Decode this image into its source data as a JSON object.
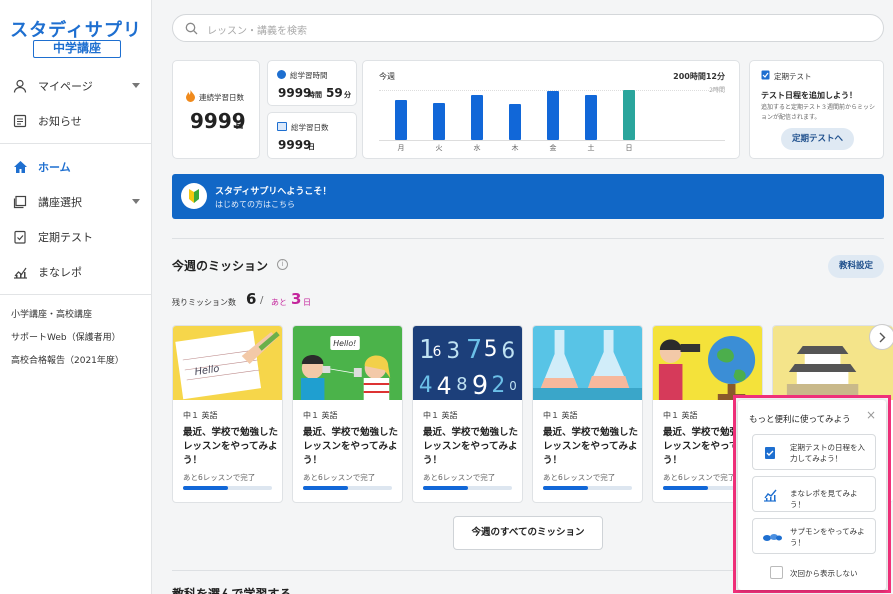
{
  "sidebar": {
    "logo": "スタディサプリ",
    "logo_sub": "中学講座",
    "items": [
      {
        "label": "マイページ",
        "icon": "person-icon"
      },
      {
        "label": "お知らせ",
        "icon": "notice-icon"
      },
      {
        "label": "ホーム",
        "icon": "home-icon"
      },
      {
        "label": "講座選択",
        "icon": "course-icon"
      },
      {
        "label": "定期テスト",
        "icon": "test-icon"
      },
      {
        "label": "まなレポ",
        "icon": "chart-icon"
      }
    ],
    "links": [
      "小学講座・高校講座",
      "サポートWeb（保護者用）",
      "高校合格報告（2021年度）"
    ]
  },
  "search": {
    "placeholder": "レッスン・講義を検索"
  },
  "stats": {
    "streak_label": "連続学習日数",
    "streak_value": "9999",
    "streak_unit": "日",
    "total_time_label": "総学習時間",
    "total_time_h": "9999",
    "total_time_h_unit": "時間",
    "total_time_m": "59",
    "total_time_m_unit": "分",
    "total_days_label": "総学習日数",
    "total_days_value": "9999",
    "total_days_unit": "日"
  },
  "weekly": {
    "label": "今週",
    "total": "200時間12分",
    "axis_max": "2時間"
  },
  "chart_data": {
    "type": "bar",
    "title": "今週",
    "categories": [
      "月",
      "火",
      "水",
      "木",
      "金",
      "土",
      "日"
    ],
    "values": [
      1.6,
      1.5,
      1.8,
      1.45,
      1.95,
      1.82,
      2.0
    ],
    "ylim": [
      0,
      2
    ],
    "colors": [
      "#1167d8",
      "#1167d8",
      "#1167d8",
      "#1167d8",
      "#1167d8",
      "#1167d8",
      "#2aa59c"
    ]
  },
  "test_card": {
    "label": "定期テスト",
    "title": "テスト日程を追加しよう！",
    "desc": "追加すると定期テスト３週間前からミッションが配信されます。",
    "button": "定期テストへ"
  },
  "banner": {
    "title": "スタディサプリへようこそ！",
    "sub": "はじめての方はこちら"
  },
  "missions": {
    "heading": "今週のミッション",
    "settings_button": "教科設定",
    "remaining_label": "残りミッション数",
    "remaining_count": "6",
    "slash": "/",
    "days_prefix": "あと",
    "days_count": "3",
    "days_unit": "日",
    "cards": [
      {
        "subject": "中１ 英語",
        "title": "最近、学校で勉強したレッスンをやってみよう！",
        "rest": "あと6レッスンで完了",
        "progress": 0.5,
        "art": "Hello"
      },
      {
        "subject": "中１ 英語",
        "title": "最近、学校で勉強したレッスンをやってみよう！",
        "rest": "あと6レッスンで完了",
        "progress": 0.5,
        "art": "Hello!"
      },
      {
        "subject": "中１ 英語",
        "title": "最近、学校で勉強したレッスンをやってみよう！",
        "rest": "あと6レッスンで完了",
        "progress": 0.5,
        "art": "numbers"
      },
      {
        "subject": "中１ 英語",
        "title": "最近、学校で勉強したレッスンをやってみよう！",
        "rest": "あと6レッスンで完了",
        "progress": 0.5,
        "art": "flasks"
      },
      {
        "subject": "中１ 英語",
        "title": "最近、学校で勉強したレッスンをやってみよう！",
        "rest": "あと6レッスンで完了",
        "progress": 0.5,
        "art": "globe"
      }
    ],
    "all_button": "今週のすべてのミッション"
  },
  "next_heading": "教科を選んで学習する",
  "popup": {
    "title": "もっと便利に使ってみよう",
    "items": [
      {
        "text": "定期テストの日程を入力してみよう！",
        "icon": "test-icon"
      },
      {
        "text": "まなレポを見てみよう！",
        "icon": "chart-icon"
      },
      {
        "text": "サプモンをやってみよう！",
        "icon": "supmon-icon"
      }
    ],
    "checkbox_label": "次回から表示しない"
  }
}
